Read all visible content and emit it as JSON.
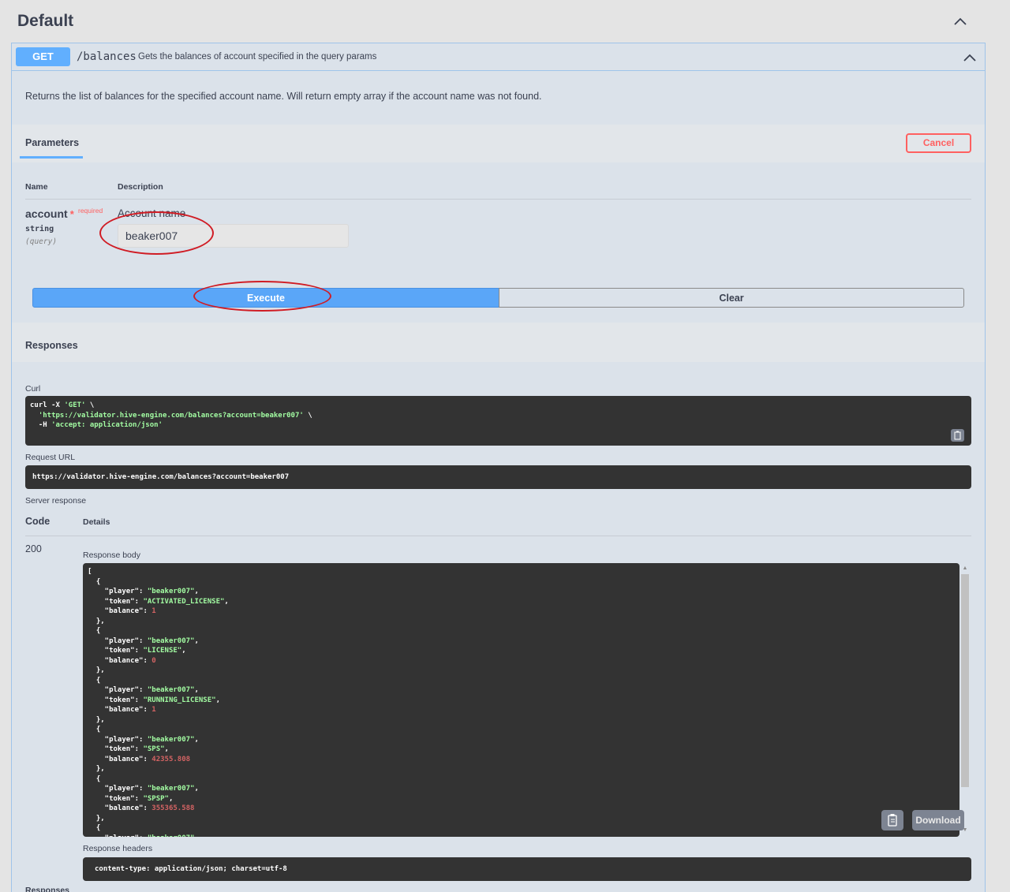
{
  "tag": {
    "title": "Default"
  },
  "operation": {
    "method": "GET",
    "path": "/balances",
    "summary": "Gets the balances of account specified in the query params",
    "description": "Returns the list of balances for the specified account name. Will return empty array if the account name was not found."
  },
  "parameters": {
    "tab_label": "Parameters",
    "cancel_label": "Cancel",
    "col_name": "Name",
    "col_description": "Description",
    "param": {
      "name": "account",
      "required_star": "*",
      "required_label": "required",
      "type": "string",
      "in": "(query)",
      "description": "Account name",
      "value": "beaker007"
    },
    "execute_label": "Execute",
    "clear_label": "Clear"
  },
  "responses": {
    "title": "Responses",
    "curl_label": "Curl",
    "curl_lines": [
      {
        "plain": "curl -X ",
        "str": "'GET'",
        "tail": " \\"
      },
      {
        "plain": "  ",
        "str": "'https://validator.hive-engine.com/balances?account=beaker007'",
        "tail": " \\"
      },
      {
        "plain": "  -H ",
        "str": "'accept: application/json'",
        "tail": ""
      }
    ],
    "request_url_label": "Request URL",
    "request_url": "https://validator.hive-engine.com/balances?account=beaker007",
    "server_response_label": "Server response",
    "code_col": "Code",
    "details_col": "Details",
    "status_code": "200",
    "response_body_label": "Response body",
    "response_body": [
      {
        "player": "beaker007",
        "token": "ACTIVATED_LICENSE",
        "balance": "1"
      },
      {
        "player": "beaker007",
        "token": "LICENSE",
        "balance": "0"
      },
      {
        "player": "beaker007",
        "token": "RUNNING_LICENSE",
        "balance": "1"
      },
      {
        "player": "beaker007",
        "token": "SPS",
        "balance": "42355.808"
      },
      {
        "player": "beaker007",
        "token": "SPSP",
        "balance": "355365.588"
      }
    ],
    "download_label": "Download",
    "response_headers_label": "Response headers",
    "response_headers": "content-type: application/json; charset=utf-8",
    "footer_label": "Responses"
  },
  "colors": {
    "get_method": "#61affe",
    "cancel": "#ff6060",
    "annotation": "#d01c24",
    "code_bg": "#333333",
    "string": "#a2fca2",
    "number": "#d36363"
  },
  "icons": [
    "chevron-up-icon",
    "copy-icon"
  ]
}
